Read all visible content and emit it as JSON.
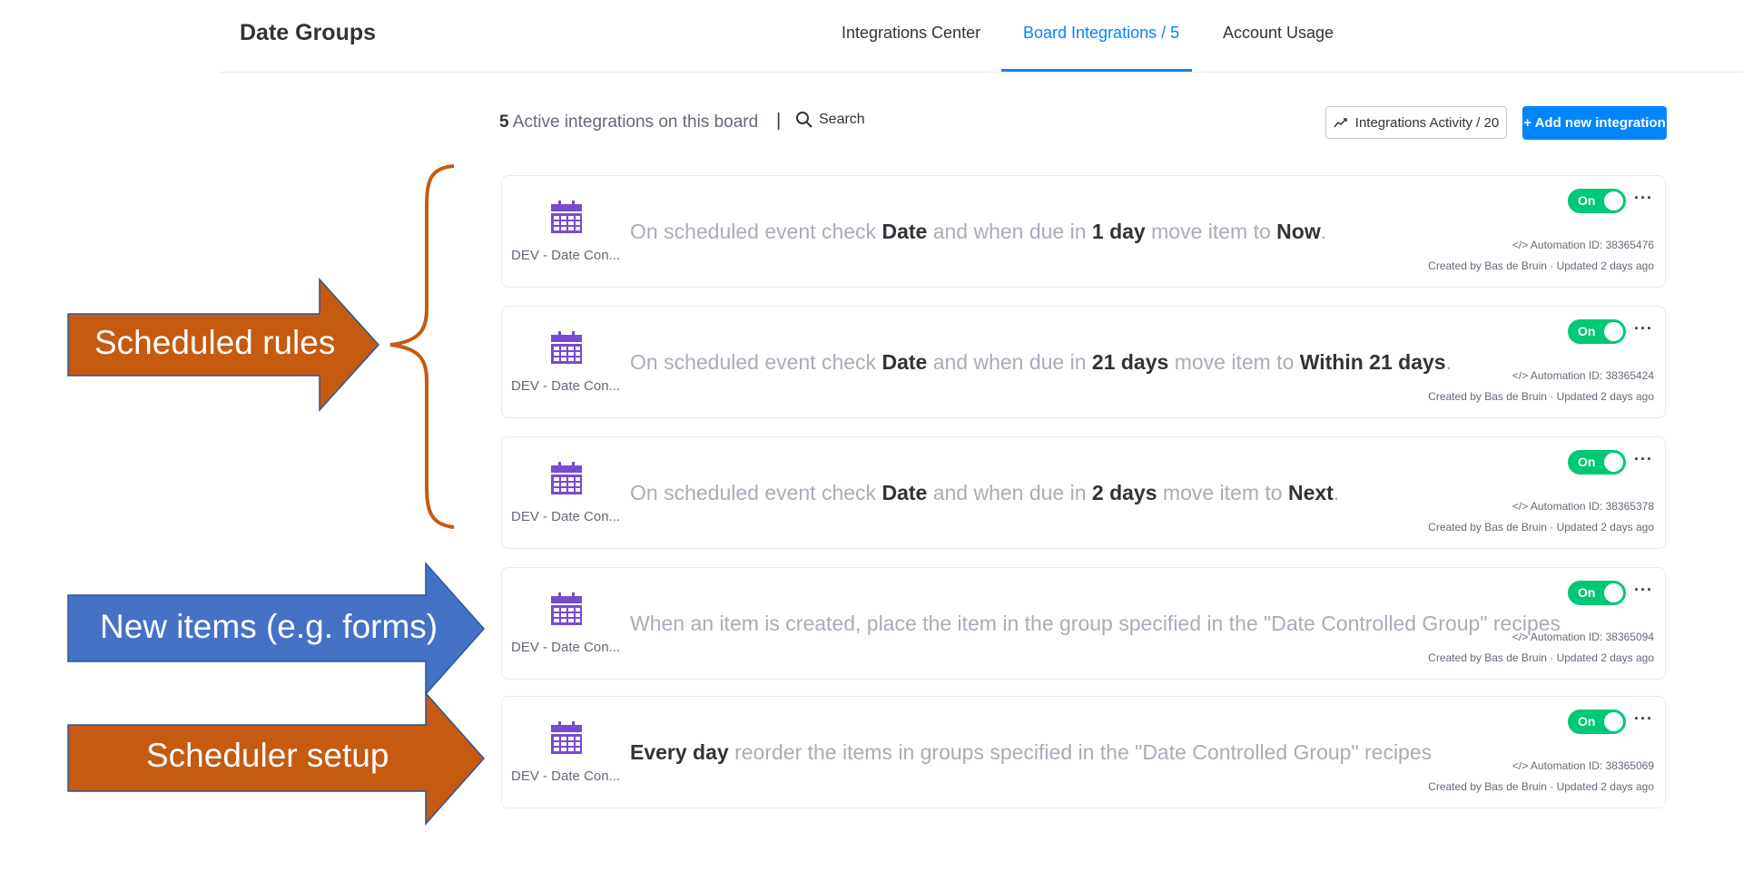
{
  "header": {
    "board_title": "Date Groups",
    "tabs": [
      {
        "label": "Integrations Center",
        "active": false
      },
      {
        "label": "Board Integrations / 5",
        "active": true
      },
      {
        "label": "Account Usage",
        "active": false
      }
    ]
  },
  "toolbar": {
    "active_count": "5",
    "active_text": " Active integrations on this board",
    "separator": "|",
    "search_label": "Search",
    "activity_label": "Integrations Activity / 20",
    "add_label": "+ Add new integration"
  },
  "colors": {
    "accent": "#0085ff",
    "toggle_on": "#00c875",
    "icon_purple": "#784bd1",
    "orange_arrow": "#c55a11",
    "blue_arrow": "#4472c4"
  },
  "cards": [
    {
      "app_name": "DEV - Date Con...",
      "recipe": [
        {
          "t": "On scheduled event check ",
          "b": false
        },
        {
          "t": "Date",
          "b": true
        },
        {
          "t": " and when due in ",
          "b": false
        },
        {
          "t": "1 day",
          "b": true
        },
        {
          "t": " move item to ",
          "b": false
        },
        {
          "t": "Now",
          "b": true
        },
        {
          "t": ".",
          "b": false
        }
      ],
      "toggle": "On",
      "automation_id": "</> Automation ID: 38365476",
      "created": "Created by Bas de Bruin · Updated 2 days ago"
    },
    {
      "app_name": "DEV - Date Con...",
      "recipe": [
        {
          "t": "On scheduled event check ",
          "b": false
        },
        {
          "t": "Date",
          "b": true
        },
        {
          "t": " and when due in ",
          "b": false
        },
        {
          "t": "21 days",
          "b": true
        },
        {
          "t": " move item to ",
          "b": false
        },
        {
          "t": "Within 21 days",
          "b": true
        },
        {
          "t": ".",
          "b": false
        }
      ],
      "toggle": "On",
      "automation_id": "</> Automation ID: 38365424",
      "created": "Created by Bas de Bruin · Updated 2 days ago"
    },
    {
      "app_name": "DEV - Date Con...",
      "recipe": [
        {
          "t": "On scheduled event check ",
          "b": false
        },
        {
          "t": "Date",
          "b": true
        },
        {
          "t": " and when due in ",
          "b": false
        },
        {
          "t": "2 days",
          "b": true
        },
        {
          "t": " move item to ",
          "b": false
        },
        {
          "t": "Next",
          "b": true
        },
        {
          "t": ".",
          "b": false
        }
      ],
      "toggle": "On",
      "automation_id": "</> Automation ID: 38365378",
      "created": "Created by Bas de Bruin · Updated 2 days ago"
    },
    {
      "app_name": "DEV - Date Con...",
      "recipe": [
        {
          "t": "When an item is created, place the item in the group specified in the \"Date Controlled Group\" recipes",
          "b": false
        }
      ],
      "toggle": "On",
      "automation_id": "</> Automation ID: 38365094",
      "created": "Created by Bas de Bruin · Updated 2 days ago"
    },
    {
      "app_name": "DEV - Date Con...",
      "recipe": [
        {
          "t": "Every day",
          "b": true
        },
        {
          "t": " reorder the items in groups specified in the \"Date Controlled Group\" recipes",
          "b": false
        }
      ],
      "toggle": "On",
      "automation_id": "</> Automation ID: 38365069",
      "created": "Created by Bas de Bruin · Updated 2 days ago"
    }
  ],
  "annotations": {
    "scheduled_rules": "Scheduled rules",
    "new_items": "New items (e.g. forms)",
    "scheduler_setup": "Scheduler setup"
  }
}
